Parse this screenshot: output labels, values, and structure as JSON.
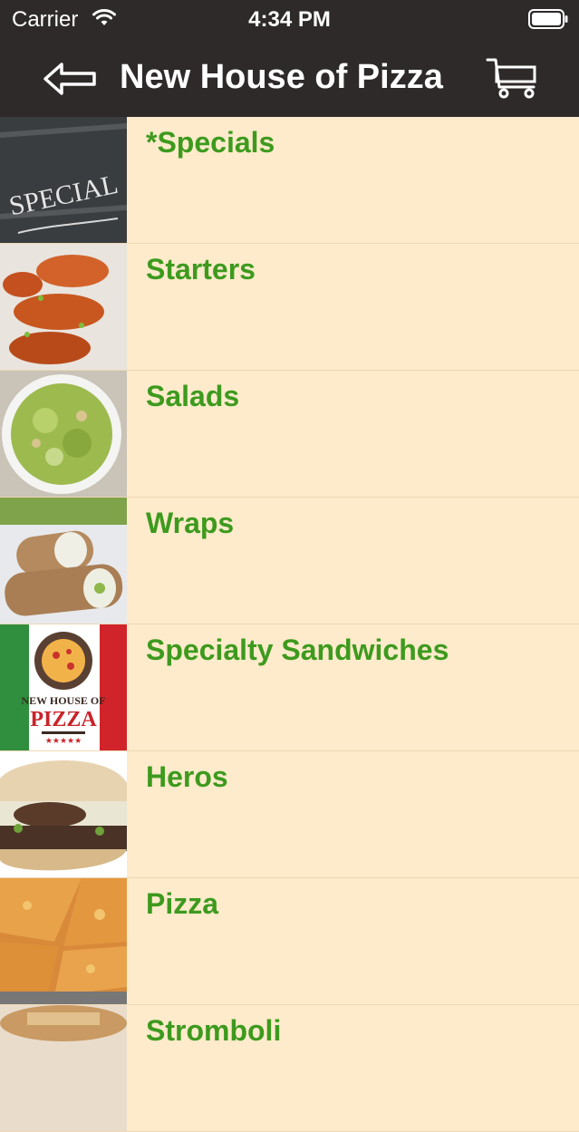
{
  "status_bar": {
    "carrier": "Carrier",
    "time": "4:34 PM",
    "wifi_icon": "wifi-icon",
    "battery_icon": "battery-icon"
  },
  "nav": {
    "title": "New House of Pizza",
    "back_icon": "back-arrow-icon",
    "cart_icon": "shopping-cart-icon"
  },
  "categories": [
    {
      "label": "*Specials",
      "image": "chalkboard-specials-image",
      "thumb_text": "SPECIAL"
    },
    {
      "label": "Starters",
      "image": "chicken-wings-image"
    },
    {
      "label": "Salads",
      "image": "caesar-salad-image"
    },
    {
      "label": "Wraps",
      "image": "wraps-image"
    },
    {
      "label": "Specialty Sandwiches",
      "image": "new-house-of-pizza-logo",
      "thumb_text": "NEW HOUSE OF",
      "thumb_text2": "PIZZA"
    },
    {
      "label": "Heros",
      "image": "steak-hero-image"
    },
    {
      "label": "Pizza",
      "image": "pizza-image"
    },
    {
      "label": "Stromboli",
      "image": "stromboli-image"
    }
  ],
  "colors": {
    "bar_background": "#2E2A29",
    "list_background": "#FDEBCB",
    "label_green": "#3D9A1E"
  }
}
